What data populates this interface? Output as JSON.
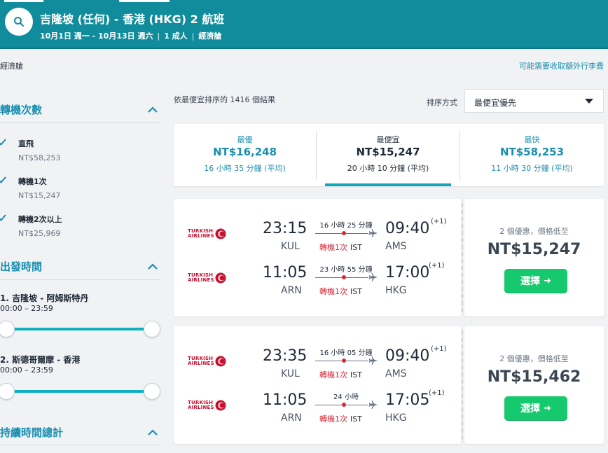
{
  "header": {
    "title": "吉隆坡 (任何) - 香港 (HKG) 2 航班",
    "dates": "10月1日 週一 - 10月13日 週六",
    "passengers": "1 成人",
    "cabin": "經濟艙",
    "separator": "|"
  },
  "subbar": {
    "cabin": "經濟艙",
    "bag_fee_link": "可能需要收取額外行李費"
  },
  "sidebar": {
    "stops": {
      "title": "轉機次數",
      "options": [
        {
          "label": "直飛",
          "price": "NT$58,253",
          "checked": true
        },
        {
          "label": "轉機1次",
          "price": "NT$15,247",
          "checked": true
        },
        {
          "label": "轉機2次以上",
          "price": "NT$25,969",
          "checked": true
        }
      ]
    },
    "departure": {
      "title": "出發時間",
      "segments": [
        {
          "title": "1. 吉隆坡 - 阿姆斯特丹",
          "range": "00:00 – 23:59"
        },
        {
          "title": "2. 斯德哥爾摩 - 香港",
          "range": "00:00 – 23:59"
        }
      ]
    },
    "duration": {
      "title": "持續時間總計"
    }
  },
  "main": {
    "results_count": "依最便宜排序的 1416 個結果",
    "sort_label": "排序方式",
    "sort_value": "最便宜優先",
    "tabs": [
      {
        "label": "最優",
        "price": "NT$16,248",
        "duration": "16 小時 35 分鐘 (平均)",
        "active": false
      },
      {
        "label": "最便宜",
        "price": "NT$15,247",
        "duration": "20 小時 10 分鐘 (平均)",
        "active": true
      },
      {
        "label": "最快",
        "price": "NT$58,253",
        "duration": "11 小時 30 分鐘 (平均)",
        "active": false
      }
    ],
    "results": [
      {
        "deals": "2 個優惠，價格低至",
        "price": "NT$15,247",
        "select_label": "選擇",
        "legs": [
          {
            "airline": "TURKISH AIRLINES",
            "dep_time": "23:15",
            "dep_code": "KUL",
            "duration": "16 小時 25 分鐘",
            "stops": "轉機1次",
            "stop_airport": "IST",
            "arr_time": "09:40",
            "day_offset": "(+1)",
            "arr_code": "AMS"
          },
          {
            "airline": "TURKISH AIRLINES",
            "dep_time": "11:05",
            "dep_code": "ARN",
            "duration": "23 小時 55 分鐘",
            "stops": "轉機1次",
            "stop_airport": "IST",
            "arr_time": "17:00",
            "day_offset": "(+1)",
            "arr_code": "HKG"
          }
        ]
      },
      {
        "deals": "2 個優惠，價格低至",
        "price": "NT$15,462",
        "select_label": "選擇",
        "legs": [
          {
            "airline": "TURKISH AIRLINES",
            "dep_time": "23:35",
            "dep_code": "KUL",
            "duration": "16 小時 05 分鐘",
            "stops": "轉機1次",
            "stop_airport": "IST",
            "arr_time": "09:40",
            "day_offset": "(+1)",
            "arr_code": "AMS"
          },
          {
            "airline": "TURKISH AIRLINES",
            "dep_time": "11:05",
            "dep_code": "ARN",
            "duration": "24 小時",
            "stops": "轉機1次",
            "stop_airport": "IST",
            "arr_time": "17:05",
            "day_offset": "(+1)",
            "arr_code": "HKG"
          }
        ]
      }
    ]
  },
  "colors": {
    "header_bg": "#118c9c",
    "accent": "#1a8fb0",
    "select_green": "#17c96e",
    "stop_red": "#d42a3a",
    "airline_red": "#c8102e"
  },
  "icons": {
    "search": "search-icon",
    "chevron_up": "chevron-up-icon",
    "check": "check-icon",
    "caret_down": "caret-down-icon",
    "plane": "plane-icon",
    "airline_logo": "turkish-airlines-logo",
    "select_arrow": "arrow-right-icon"
  }
}
